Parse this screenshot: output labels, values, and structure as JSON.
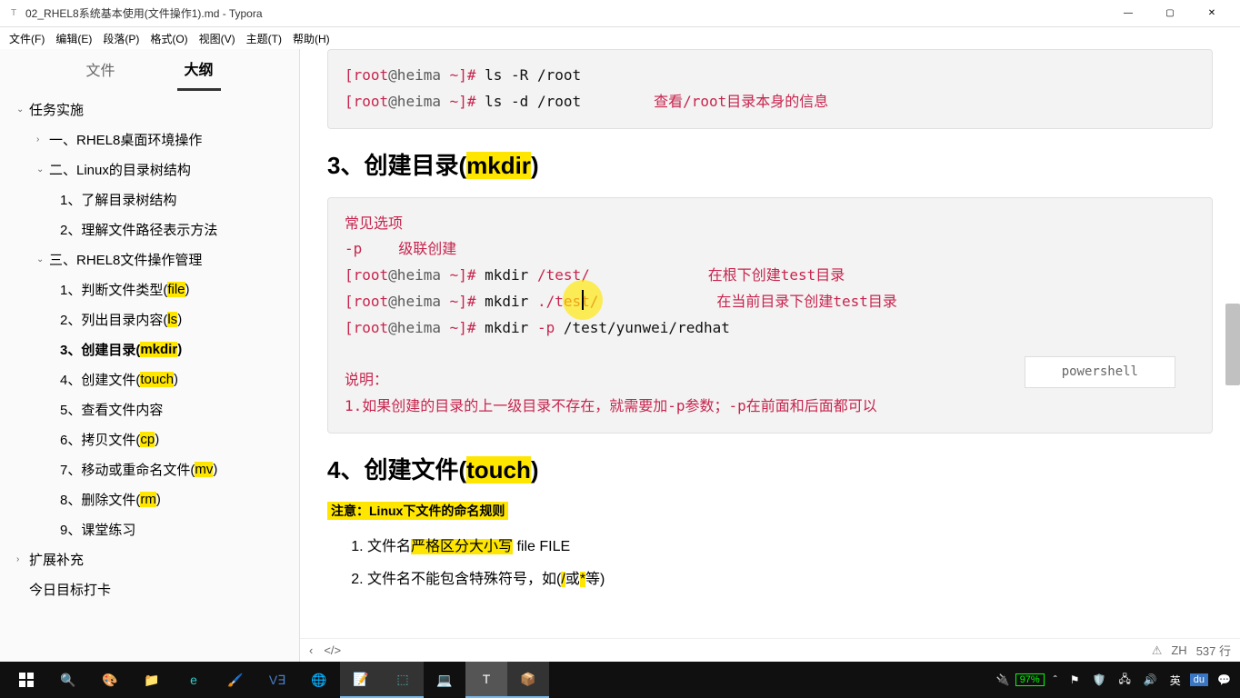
{
  "window": {
    "title": "02_RHEL8系统基本使用(文件操作1).md - Typora",
    "app_icon": "T"
  },
  "win_controls": {
    "min": "—",
    "max": "▢",
    "close": "✕"
  },
  "menus": [
    "文件(F)",
    "编辑(E)",
    "段落(P)",
    "格式(O)",
    "视图(V)",
    "主题(T)",
    "帮助(H)"
  ],
  "sidebar_tabs": {
    "file": "文件",
    "outline": "大纲"
  },
  "outline": {
    "n0": "任务实施",
    "n1": "一、RHEL8桌面环境操作",
    "n2": "二、Linux的目录树结构",
    "n2a": "1、了解目录树结构",
    "n2b": "2、理解文件路径表示方法",
    "n3": "三、RHEL8文件操作管理",
    "n3a_pre": "1、判断文件类型(",
    "n3a_hl": "file",
    "n3a_post": ")",
    "n3b_pre": "2、列出目录内容(",
    "n3b_hl": "ls",
    "n3b_post": ")",
    "n3c_pre": "3、创建目录(",
    "n3c_hl": "mkdir",
    "n3c_post": ")",
    "n3d_pre": "4、创建文件(",
    "n3d_hl": "touch",
    "n3d_post": ")",
    "n3e": "5、查看文件内容",
    "n3f_pre": "6、拷贝文件(",
    "n3f_hl": "cp",
    "n3f_post": ")",
    "n3g_pre": "7、移动或重命名文件(",
    "n3g_hl": "mv",
    "n3g_post": ")",
    "n3h_pre": "8、删除文件(",
    "n3h_hl": "rm",
    "n3h_post": ")",
    "n3i": "9、课堂练习",
    "n4": "扩展补充",
    "n5": "今日目标打卡"
  },
  "code1": {
    "l1_a": "[root",
    "l1_b": "@heima ",
    "l1_c": "~]# ",
    "l1_d": "ls -R /root",
    "l2_a": "[root",
    "l2_b": "@heima ",
    "l2_c": "~]# ",
    "l2_d": "ls -d /root",
    "l2_note": "查看/root目录本身的信息"
  },
  "h3a_pre": "3、创建目录(",
  "h3a_hl": "mkdir",
  "h3a_post": ")",
  "code2": {
    "opt_title": "常见选项",
    "opt_p": "-p",
    "opt_p_desc": "级联创建",
    "l1_a": "[root",
    "l1_b": "@heima ",
    "l1_c": "~]# ",
    "l1_d": "mkdir ",
    "l1_e": "/test/",
    "l1_note": "在根下创建test目录",
    "l2_a": "[root",
    "l2_b": "@heima ",
    "l2_c": "~]# ",
    "l2_d": "mkdir ",
    "l2_e1": "./",
    "l2_e2": "test/",
    "l2_note": "在当前目录下创建test目录",
    "l3_a": "[root",
    "l3_b": "@heima ",
    "l3_c": "~]# ",
    "l3_d": "mkdir ",
    "l3_e": "-p",
    "l3_f": " /test/yunwei/redhat",
    "note_t": "说明：",
    "note_1": "1.如果创建的目录的上一级目录不存在，就需要加-p参数；-p在前面和后面都可以",
    "lang": "powershell"
  },
  "h3b_pre": "4、创建文件(",
  "h3b_hl": "touch",
  "h3b_post": ")",
  "notice": "注意：Linux下文件的命名规则",
  "rule1_a": "文件名",
  "rule1_hl": "严格区分大小写",
  "rule1_b": " file  FILE",
  "rule2_a": "文件名不能包含特殊符号，如(",
  "rule2_hl1": "/",
  "rule2_mid": "或",
  "rule2_hl2": "*",
  "rule2_b": "等)",
  "status": {
    "arrow": "‹",
    "code": "</>",
    "warn": "⚠",
    "lang": "ZH",
    "lines": "537 行"
  },
  "tray": {
    "battery": "97%",
    "ime_lang": "英",
    "ime_brand": "du"
  }
}
